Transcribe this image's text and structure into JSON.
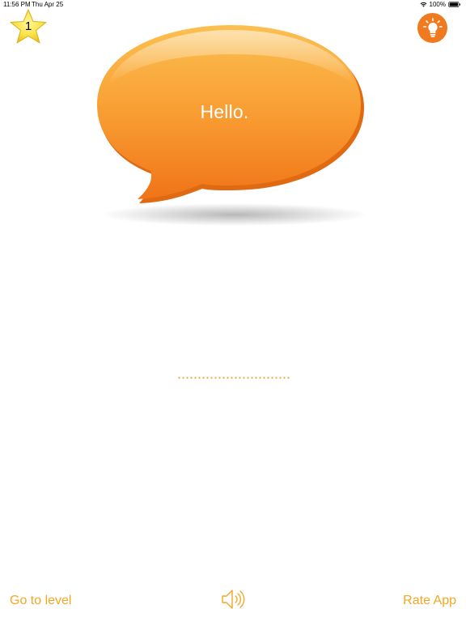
{
  "status_bar": {
    "time": "11:56 PM",
    "date": "Thu Apr 25",
    "battery_percent": "100%",
    "wifi_icon": "wifi-icon",
    "battery_icon": "battery-icon"
  },
  "level_badge": {
    "icon": "star-icon",
    "level": "1"
  },
  "hint": {
    "icon": "lightbulb-icon"
  },
  "bubble": {
    "icon": "speech-bubble",
    "text": "Hello."
  },
  "answer": {
    "slot_count": 28
  },
  "bottom_bar": {
    "go_to_level_label": "Go to level",
    "rate_app_label": "Rate App",
    "sound_icon": "speaker-icon"
  },
  "colors": {
    "accent": "#f5a623",
    "hint_bg": "#f07a1f",
    "bubble_top": "#fbb545",
    "bubble_bottom": "#f07a1f",
    "star_fill": "#fbe34a"
  }
}
